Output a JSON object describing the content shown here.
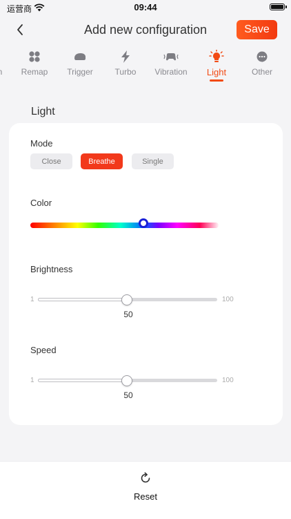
{
  "status_bar": {
    "carrier": "运营商",
    "time": "09:44"
  },
  "nav": {
    "title": "Add new configuration",
    "save_label": "Save"
  },
  "tabs": [
    {
      "label": "n",
      "icon": "partial-tab"
    },
    {
      "label": "Remap",
      "icon": "remap-icon"
    },
    {
      "label": "Trigger",
      "icon": "trigger-icon"
    },
    {
      "label": "Turbo",
      "icon": "lightning-icon"
    },
    {
      "label": "Vibration",
      "icon": "vibration-icon"
    },
    {
      "label": "Light",
      "icon": "bulb-icon",
      "active": true
    },
    {
      "label": "Other",
      "icon": "more-icon"
    }
  ],
  "section_title": "Light",
  "mode": {
    "label": "Mode",
    "options": [
      "Close",
      "Breathe",
      "Single"
    ],
    "selected": "Breathe"
  },
  "color": {
    "label": "Color",
    "position": 0.63
  },
  "brightness": {
    "label": "Brightness",
    "min": "1",
    "max": "100",
    "value": "50"
  },
  "speed": {
    "label": "Speed",
    "min": "1",
    "max": "100",
    "value": "50"
  },
  "reset": {
    "label": "Reset"
  },
  "colors": {
    "accent": "#f24a14",
    "knob_border": "#1a20d6"
  }
}
